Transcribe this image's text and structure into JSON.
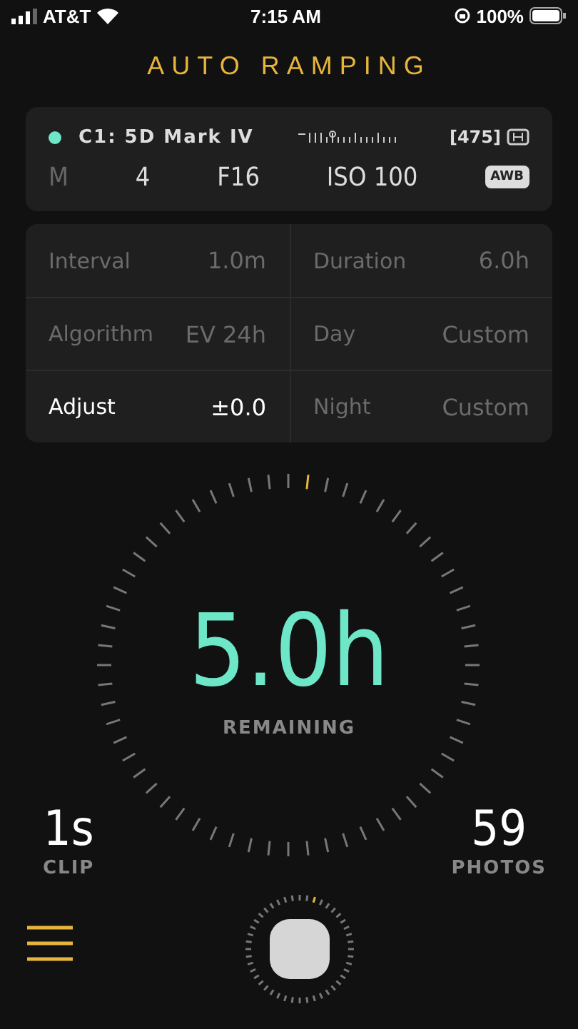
{
  "status_bar": {
    "carrier": "AT&T",
    "time": "7:15 AM",
    "battery": "100%"
  },
  "title": "AUTO RAMPING",
  "camera": {
    "connected": true,
    "name": "C1: 5D Mark IV",
    "shots": "[475]",
    "settings": [
      {
        "value": "M",
        "disabled": true
      },
      {
        "value": "4",
        "disabled": false
      },
      {
        "value": "F16",
        "disabled": false
      },
      {
        "value": "ISO 100",
        "disabled": false
      }
    ],
    "white_balance": "AWB"
  },
  "parameters": [
    {
      "label": "Interval",
      "value": "1.0m",
      "selected": false
    },
    {
      "label": "Duration",
      "value": "6.0h",
      "selected": false
    },
    {
      "label": "Algorithm",
      "value": "EV 24h",
      "selected": false
    },
    {
      "label": "Day",
      "value": "Custom",
      "selected": false
    },
    {
      "label": "Adjust",
      "value": "±0.0",
      "selected": true
    },
    {
      "label": "Night",
      "value": "Custom",
      "selected": false
    }
  ],
  "countdown": {
    "value": "5.0h",
    "label": "REMAINING"
  },
  "clip": {
    "value": "1s",
    "label": "CLIP"
  },
  "photos": {
    "value": "59",
    "label": "PHOTOS"
  }
}
